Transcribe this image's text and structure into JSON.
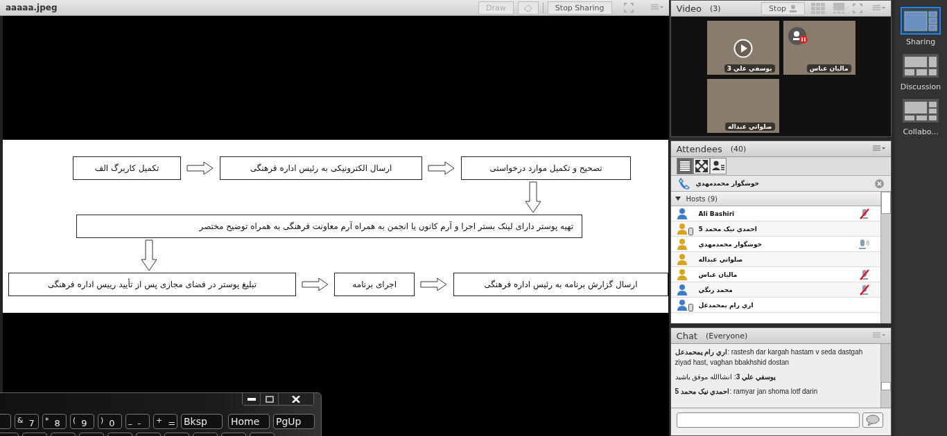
{
  "share_pod": {
    "title": "aaaaa.jpeg",
    "draw_button": {
      "label": "Draw",
      "disabled": true
    },
    "stop_sharing_button": {
      "label": "Stop Sharing",
      "disabled": false
    },
    "flowchart": {
      "rows": [
        [
          "تصحیح و تکمیل موارد درخواستی",
          "ارسال الکترونیکی به رئیس اداره فرهنگی",
          "تکمیل کاربرگ الف"
        ],
        [
          "تهیه پوستر دارای لینک بستر اجرا و آرم کانون یا انجمن به همراه آرم معاونت فرهنگی به همراه توضیح مختصر"
        ],
        [
          "ارسال گزارش برنامه به رئیس اداره فرهنگی",
          "اجرای برنامه",
          "تبلیغ پوستر در فضای مجازی پس از تأیید رییس اداره فرهنگی"
        ]
      ]
    }
  },
  "video_pod": {
    "title": "Video",
    "count": "(3)",
    "stop_label": "Stop",
    "tile_rows": [
      [
        {
          "name": "ماليان عباس",
          "kind": "paused"
        },
        {
          "name": "يوسفي علي 3",
          "kind": "play"
        }
      ],
      [
        {
          "name": "صلواتي عبداله",
          "kind": "plain"
        }
      ]
    ]
  },
  "attendees_pod": {
    "title": "Attendees",
    "count": "(40)",
    "speaker": "خوشگوار محمدمهدي",
    "group": {
      "label": "Hosts (9)",
      "expanded": true
    },
    "people": [
      {
        "name": "Ali Bashiri",
        "color": "#3d7cc9",
        "mobile": false,
        "muted": true,
        "speaking": false
      },
      {
        "name": "احمدي نيک محمد 5",
        "color": "#d9a520",
        "mobile": true,
        "muted": false,
        "speaking": false
      },
      {
        "name": "خوشگوار محمدمهدي",
        "color": "#d9a520",
        "mobile": false,
        "muted": false,
        "speaking": true
      },
      {
        "name": "صلواتي عبداله",
        "color": "#d9a520",
        "mobile": false,
        "muted": false,
        "speaking": false
      },
      {
        "name": "ماليان عباس",
        "color": "#d9a520",
        "mobile": false,
        "muted": true,
        "speaking": false
      },
      {
        "name": "محمد رنگي",
        "color": "#3d7cc9",
        "mobile": false,
        "muted": true,
        "speaking": false
      },
      {
        "name": "اري رام يمحمدعل",
        "color": "#3d7cc9",
        "mobile": true,
        "muted": false,
        "speaking": false
      }
    ]
  },
  "chat_pod": {
    "title": "Chat",
    "audience": "(Everyone)",
    "messages": [
      "**اري رام يمحمدعل**: rastesh dar kargah hastam v seda dastgah ziyad hast, vaghan bbakhshid dostan",
      "**يوسفي علي 3**: انشاالله موفق باشيد",
      "**احمدي نيک محمد 5**: ramyar jan shoma lotf darin"
    ]
  },
  "layouts": [
    {
      "label": "Sharing",
      "selected": true
    },
    {
      "label": "Discussion",
      "selected": false
    },
    {
      "label": "Collabo...",
      "selected": false
    }
  ],
  "keyboard": {
    "keys": [
      {
        "kind": "word",
        "label": "PgUp"
      },
      {
        "kind": "word",
        "label": "Home"
      },
      {
        "kind": "word",
        "label": "Bksp"
      },
      {
        "kind": "dual",
        "label": "$^{+}$ ="
      },
      {
        "kind": "dual",
        "label": "$^{_}$ -"
      },
      {
        "kind": "dual",
        "label": "$^{)}$ 0"
      },
      {
        "kind": "dual",
        "label": "$^{(}$ 9"
      },
      {
        "kind": "dual",
        "label": "$^{*}$ 8"
      },
      {
        "kind": "dual",
        "label": "$^{&}$ 7"
      }
    ]
  }
}
